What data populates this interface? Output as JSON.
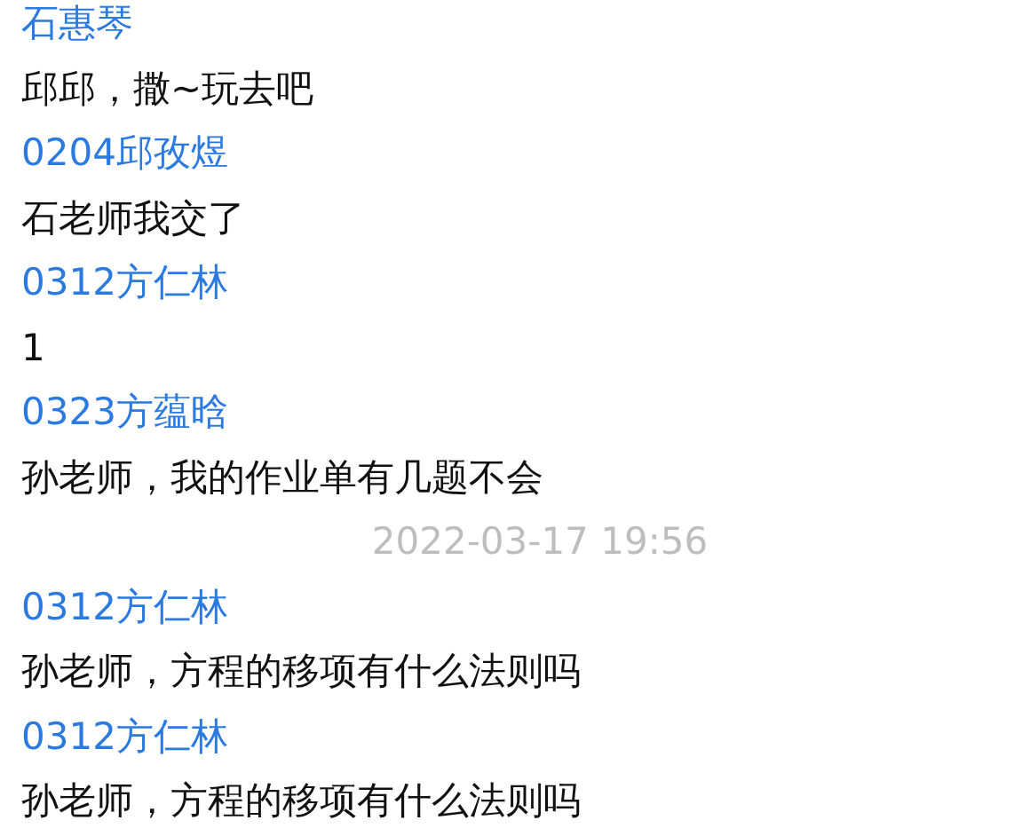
{
  "messages": [
    {
      "kind": "message",
      "sender": "石惠琴",
      "text": "邱邱，撒~玩去吧"
    },
    {
      "kind": "message",
      "sender": "0204邱孜煜",
      "text": "石老师我交了"
    },
    {
      "kind": "message",
      "sender": "0312方仁林",
      "text": "1"
    },
    {
      "kind": "message",
      "sender": "0323方蕴晗",
      "text": "孙老师，我的作业单有几题不会"
    },
    {
      "kind": "timestamp",
      "text": "2022-03-17 19:56"
    },
    {
      "kind": "message",
      "sender": "0312方仁林",
      "text": "孙老师，方程的移项有什么法则吗"
    },
    {
      "kind": "message",
      "sender": "0312方仁林",
      "text": "孙老师，方程的移项有什么法则吗"
    }
  ]
}
